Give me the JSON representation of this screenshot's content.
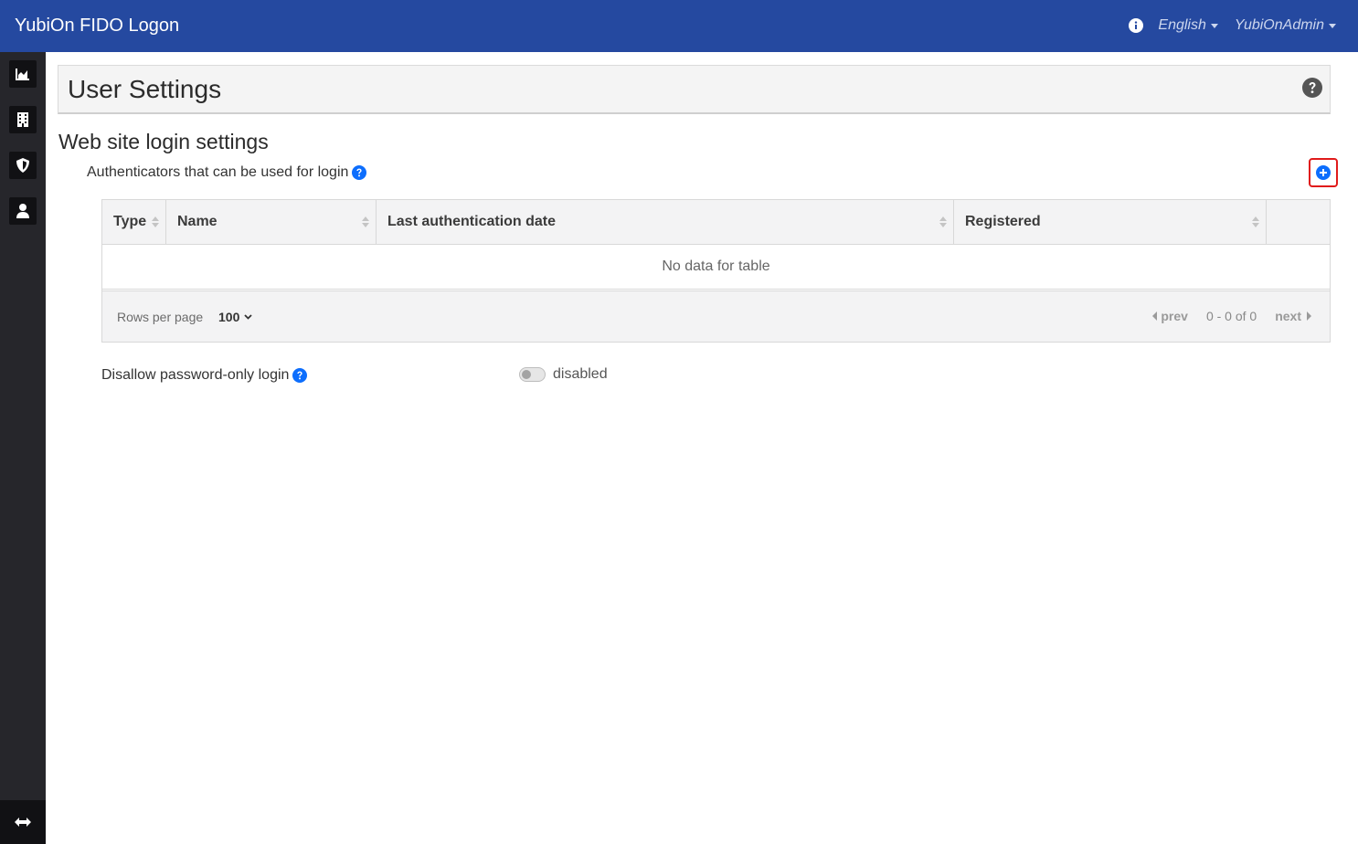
{
  "app": {
    "title": "YubiOn FIDO Logon"
  },
  "nav": {
    "language": "English",
    "user": "YubiOnAdmin"
  },
  "sidebar": {
    "items": [
      {
        "icon": "chart-area-icon"
      },
      {
        "icon": "building-icon"
      },
      {
        "icon": "shield-icon"
      },
      {
        "icon": "user-icon"
      }
    ],
    "toggle_icon": "arrows-horizontal-icon"
  },
  "page": {
    "title": "User Settings",
    "section_title": "Web site login settings",
    "authenticators_label": "Authenticators that can be used for login"
  },
  "table": {
    "columns": [
      "Type",
      "Name",
      "Last authentication date",
      "Registered",
      ""
    ],
    "empty_text": "No data for table",
    "rows_per_page_label": "Rows per page",
    "rows_per_page_value": "100",
    "prev_label": "prev",
    "next_label": "next",
    "range_text": "0 - 0 of 0"
  },
  "password_only": {
    "label": "Disallow password-only login",
    "state_text": "disabled",
    "enabled": false
  },
  "colors": {
    "navbar": "#2549a0",
    "accent": "#0d6efd",
    "highlight": "#e01b1b"
  }
}
